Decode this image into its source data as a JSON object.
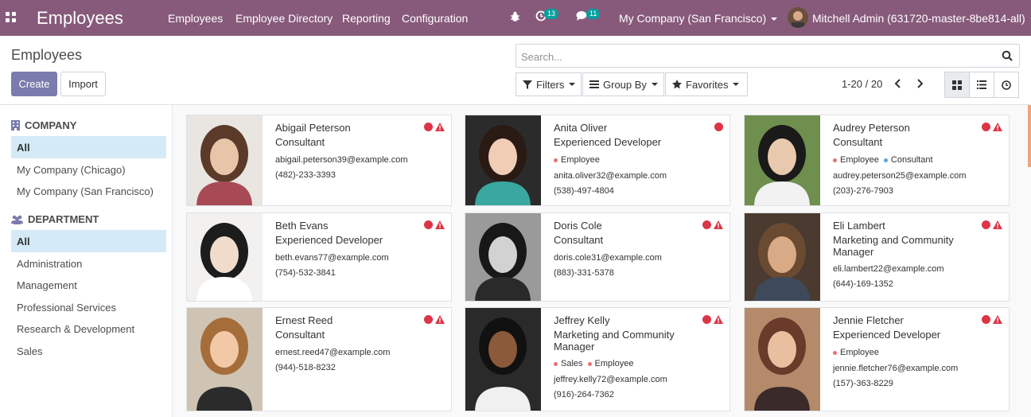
{
  "app": {
    "title": "Employees"
  },
  "nav": [
    "Employees",
    "Employee Directory",
    "Reporting",
    "Configuration"
  ],
  "systray": {
    "activity_count": "13",
    "messages_count": "11",
    "company": "My Company (San Francisco)",
    "user": "Mitchell Admin (631720-master-8be814-all)"
  },
  "breadcrumb": "Employees",
  "buttons": {
    "create": "Create",
    "import": "Import"
  },
  "search": {
    "placeholder": "Search..."
  },
  "filters": {
    "filters": "Filters",
    "groupby": "Group By",
    "favorites": "Favorites"
  },
  "pager": "1-20 / 20",
  "sidebar": {
    "company": {
      "title": "COMPANY",
      "items": [
        "All",
        "My Company (Chicago)",
        "My Company (San Francisco)"
      ]
    },
    "department": {
      "title": "DEPARTMENT",
      "items": [
        "All",
        "Administration",
        "Management",
        "Professional Services",
        "Research & Development",
        "Sales"
      ]
    }
  },
  "colors": {
    "topbar": "#875a7b",
    "primary": "#7c7bad",
    "status_red": "#dc3545",
    "tag_employee": "#e57373",
    "tag_consultant": "#5ba7d8"
  },
  "employees": [
    {
      "name": "Abigail Peterson",
      "job": "Consultant",
      "tags": [],
      "email": "abigail.peterson39@example.com",
      "phone": "(482)-233-3393",
      "warn": true
    },
    {
      "name": "Anita Oliver",
      "job": "Experienced Developer",
      "tags": [
        "Employee"
      ],
      "email": "anita.oliver32@example.com",
      "phone": "(538)-497-4804",
      "warn": false
    },
    {
      "name": "Audrey Peterson",
      "job": "Consultant",
      "tags": [
        "Employee",
        "Consultant"
      ],
      "email": "audrey.peterson25@example.com",
      "phone": "(203)-276-7903",
      "warn": true
    },
    {
      "name": "Beth Evans",
      "job": "Experienced Developer",
      "tags": [],
      "email": "beth.evans77@example.com",
      "phone": "(754)-532-3841",
      "warn": true
    },
    {
      "name": "Doris Cole",
      "job": "Consultant",
      "tags": [],
      "email": "doris.cole31@example.com",
      "phone": "(883)-331-5378",
      "warn": true
    },
    {
      "name": "Eli Lambert",
      "job": "Marketing and Community Manager",
      "tags": [],
      "email": "eli.lambert22@example.com",
      "phone": "(644)-169-1352",
      "warn": true
    },
    {
      "name": "Ernest Reed",
      "job": "Consultant",
      "tags": [],
      "email": "ernest.reed47@example.com",
      "phone": "(944)-518-8232",
      "warn": true
    },
    {
      "name": "Jeffrey Kelly",
      "job": "Marketing and Community Manager",
      "tags": [
        "Sales",
        "Employee"
      ],
      "email": "jeffrey.kelly72@example.com",
      "phone": "(916)-264-7362",
      "warn": true
    },
    {
      "name": "Jennie Fletcher",
      "job": "Experienced Developer",
      "tags": [
        "Employee"
      ],
      "email": "jennie.fletcher76@example.com",
      "phone": "(157)-363-8229",
      "warn": true
    }
  ]
}
